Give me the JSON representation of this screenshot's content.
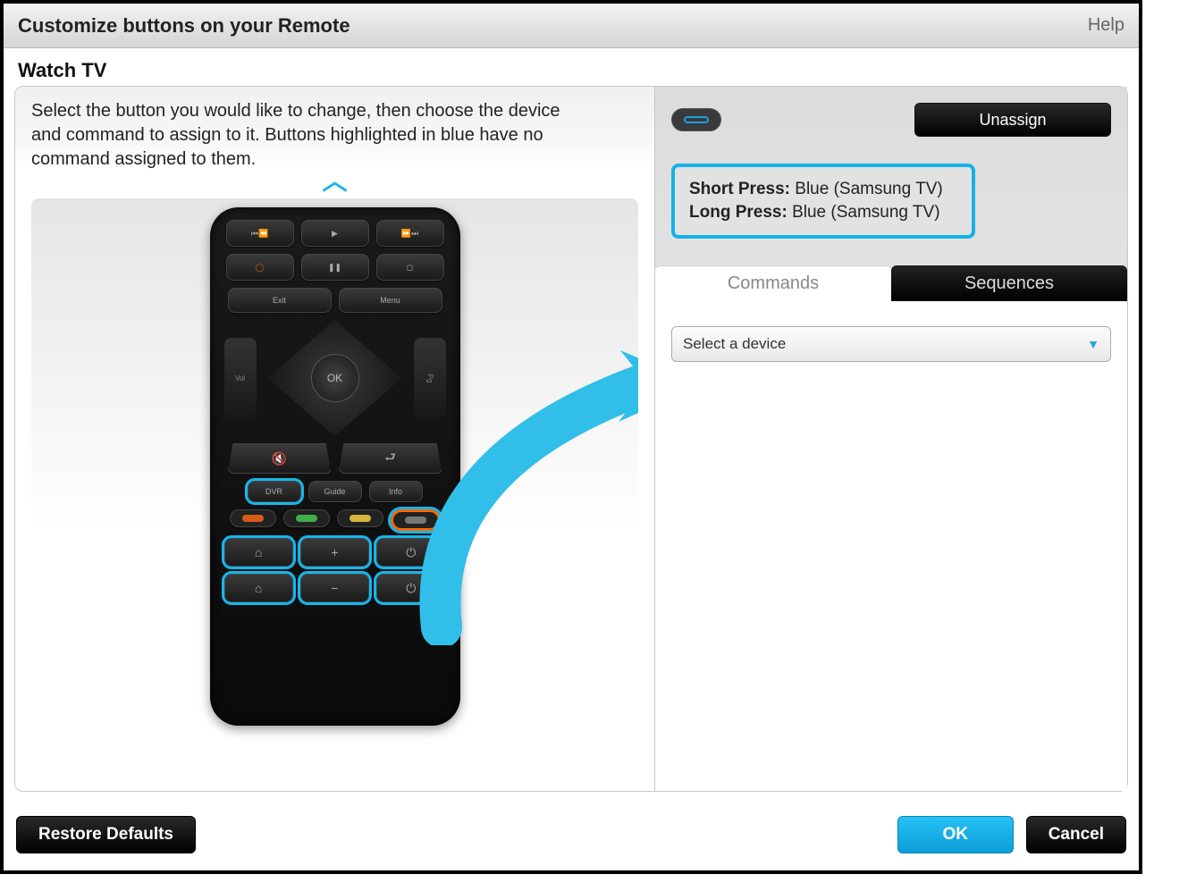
{
  "header": {
    "title": "Customize buttons on your Remote",
    "help": "Help"
  },
  "activity": "Watch TV",
  "instructions": "Select the button you would like to change, then choose the device and command to assign to it. Buttons highlighted in blue have no command assigned to them.",
  "remote": {
    "rew": "⏮⏪",
    "play": "▶",
    "fwd": "⏩⏭",
    "rec": "◯",
    "pause": "❚❚",
    "stop": "◻",
    "exit": "Exit",
    "menu": "Menu",
    "vol": "Vol",
    "ok": "OK",
    "pg": "Pg",
    "mute": "🔇",
    "back": "⮐",
    "dvr": "DVR",
    "guide": "Guide",
    "info": "Info",
    "color_red": "red",
    "color_green": "green",
    "color_yellow": "yellow",
    "color_blue": "blue",
    "light1": "⌂",
    "plus": "+",
    "socket1": "⏻",
    "light2": "⌂",
    "minus": "−",
    "socket2": "⏻"
  },
  "right": {
    "unassign": "Unassign",
    "short_label": "Short Press:",
    "short_val": "Blue (Samsung TV)",
    "long_label": "Long Press:",
    "long_val": "Blue (Samsung TV)",
    "tab_commands": "Commands",
    "tab_sequences": "Sequences",
    "device_select": "Select a device"
  },
  "footer": {
    "restore": "Restore Defaults",
    "ok": "OK",
    "cancel": "Cancel"
  }
}
